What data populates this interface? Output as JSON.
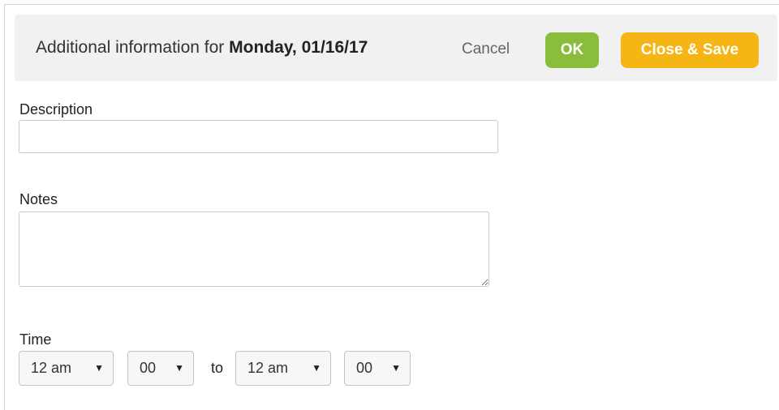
{
  "header": {
    "title_prefix": "Additional information for",
    "title_date": "Monday, 01/16/17",
    "cancel_label": "Cancel",
    "ok_label": "OK",
    "save_label": "Close & Save"
  },
  "form": {
    "description_label": "Description",
    "description_value": "",
    "notes_label": "Notes",
    "notes_value": "",
    "time_label": "Time",
    "to_label": "to",
    "start_hour": "12 am",
    "start_minute": "00",
    "end_hour": "12 am",
    "end_minute": "00"
  },
  "icons": {
    "dropdown_arrow": "▼"
  },
  "colors": {
    "ok_button": "#8bbd3c",
    "save_button": "#f5b515",
    "header_background": "#f1f1f1"
  }
}
